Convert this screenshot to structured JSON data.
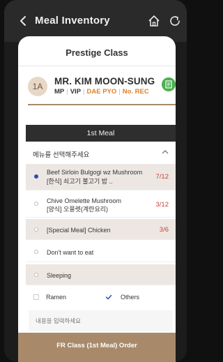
{
  "app": {
    "title": "Meal Inventory"
  },
  "sheet": {
    "class_title": "Prestige Class"
  },
  "passenger": {
    "avatar": "1A",
    "name": "MR. KIM MOON-SUNG",
    "tags": [
      "MP",
      "VIP",
      "DAE PYO",
      "No. REC"
    ]
  },
  "meal": {
    "header": "1st Meal",
    "select_label": "메뉴를 선택해주세요",
    "options": [
      {
        "line1": "Beef Sirloin Bulgogi wz Mushroom",
        "line2": "[한식] 쇠고기 불고기 밥 ..",
        "count": "7/12",
        "selected": true
      },
      {
        "line1": "Chive Omelette Mushroom",
        "line2": "[양식] 오믈렛(계란요리)",
        "count": "3/12",
        "selected": false
      },
      {
        "line1": "[Special Meal] Chicken",
        "line2": "",
        "count": "3/6",
        "selected": false
      },
      {
        "line1": "Don't want to eat",
        "line2": "",
        "count": "",
        "selected": false
      },
      {
        "line1": "Sleeping",
        "line2": "",
        "count": "",
        "selected": false
      }
    ],
    "extras": [
      {
        "label": "Ramen",
        "checked": false
      },
      {
        "label": "Others",
        "checked": true
      }
    ],
    "note_placeholder": "내용을 입력하세요",
    "order_button": "FR Class (1st Meal) Order"
  }
}
